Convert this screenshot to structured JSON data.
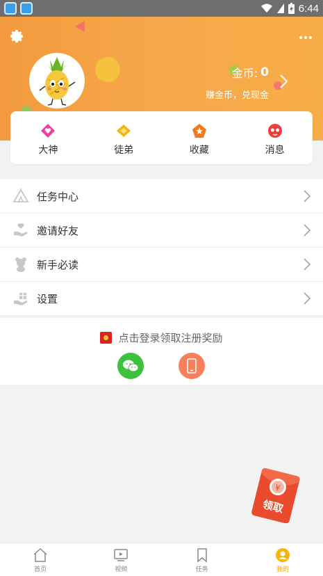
{
  "status_bar": {
    "time": "6:44"
  },
  "profile": {
    "coins_label": "金币:",
    "coins_value": "0",
    "earn_text": "赚金币，兑现金"
  },
  "quick_links": [
    {
      "label": "大神",
      "icon": "heart-diamond-icon",
      "color": "#ee3ea2"
    },
    {
      "label": "徒弟",
      "icon": "diamond-icon",
      "color": "#f5b410"
    },
    {
      "label": "收藏",
      "icon": "star-icon",
      "color": "#f4781e"
    },
    {
      "label": "消息",
      "icon": "message-icon",
      "color": "#ef3b3b"
    }
  ],
  "menu": [
    {
      "label": "任务中心",
      "icon": "tent-icon"
    },
    {
      "label": "邀请好友",
      "icon": "hand-heart-icon"
    },
    {
      "label": "新手必读",
      "icon": "bear-icon"
    },
    {
      "label": "设置",
      "icon": "gift-hand-icon"
    }
  ],
  "login": {
    "tip": "点击登录领取注册奖励"
  },
  "redpacket": {
    "label": "领取",
    "symbol": "¥"
  },
  "bottom_nav": [
    {
      "label": "首页",
      "icon": "home-icon",
      "active": false
    },
    {
      "label": "视频",
      "icon": "video-icon",
      "active": false
    },
    {
      "label": "任务",
      "icon": "bookmark-icon",
      "active": false
    },
    {
      "label": "我的",
      "icon": "profile-icon",
      "active": true
    }
  ],
  "colors": {
    "header_start": "#f39a3e",
    "header_end": "#f7ad47",
    "accent": "#f2a60c",
    "wechat": "#3cc23c",
    "phone": "#f87f5c",
    "redpacket": "#e94b2c"
  }
}
